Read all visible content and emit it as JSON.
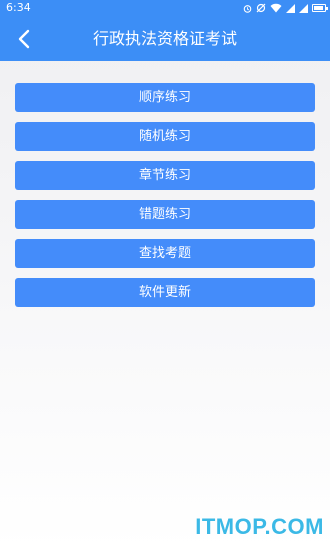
{
  "status_bar": {
    "time": "6:34",
    "icons": [
      "alarm-icon",
      "sync-off-icon",
      "wifi-icon",
      "signal-icon",
      "signal-icon",
      "battery-icon"
    ]
  },
  "header": {
    "title": "行政执法资格证考试",
    "back_icon": "chevron-left-icon"
  },
  "menu": {
    "items": [
      {
        "label": "顺序练习"
      },
      {
        "label": "随机练习"
      },
      {
        "label": "章节练习"
      },
      {
        "label": "错题练习"
      },
      {
        "label": "查找考题"
      },
      {
        "label": "软件更新"
      }
    ]
  },
  "watermark": "ITMOP.COM",
  "colors": {
    "primary": "#3c8ef6",
    "button": "#448cfa",
    "watermark": "#3bb9e6"
  }
}
